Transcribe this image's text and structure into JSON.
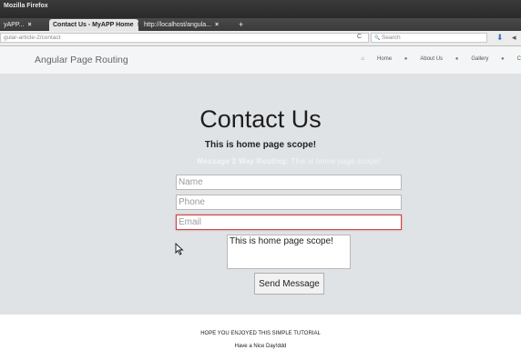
{
  "window": {
    "title": "Mozilla Firefox"
  },
  "tabs": [
    {
      "label": "yAPP...",
      "active": false
    },
    {
      "label": "Contact Us - MyAPP Home",
      "active": true
    },
    {
      "label": "http://localhost/angula...",
      "active": false
    }
  ],
  "tab_close": "×",
  "new_tab": "+",
  "navbar": {
    "url": "gular-article-2/contact",
    "reload_icon": "C",
    "search_placeholder": "Search",
    "search_icon": "🔍",
    "download_icon": "⬇",
    "more_icon": "◂"
  },
  "app": {
    "brand": "Angular Page Routing",
    "nav": [
      {
        "icon": "⌂",
        "label": "Home"
      },
      {
        "icon": "●",
        "label": "About Us"
      },
      {
        "icon": "●",
        "label": "Gallery"
      },
      {
        "icon": "●",
        "label": "C"
      }
    ]
  },
  "page": {
    "heading": "Contact Us",
    "scope_text": "This is home page scope!",
    "two_way_label": "Message 2 Way Routing:",
    "two_way_value": "This is home page scope!",
    "form": {
      "name_placeholder": "Name",
      "phone_placeholder": "Phone",
      "email_placeholder": "Email",
      "message_value": "This is home page scope!",
      "send_label": "Send Message"
    }
  },
  "footer": {
    "line1": "HOPE YOU ENJOYED THIS SIMPLE TUTORIAL",
    "line2": "Have a Nice Day!ddd"
  },
  "colors": {
    "title_bar": "#2a2a2a",
    "page_background": "#dfe3e6",
    "email_invalid_border": "#c94545"
  }
}
